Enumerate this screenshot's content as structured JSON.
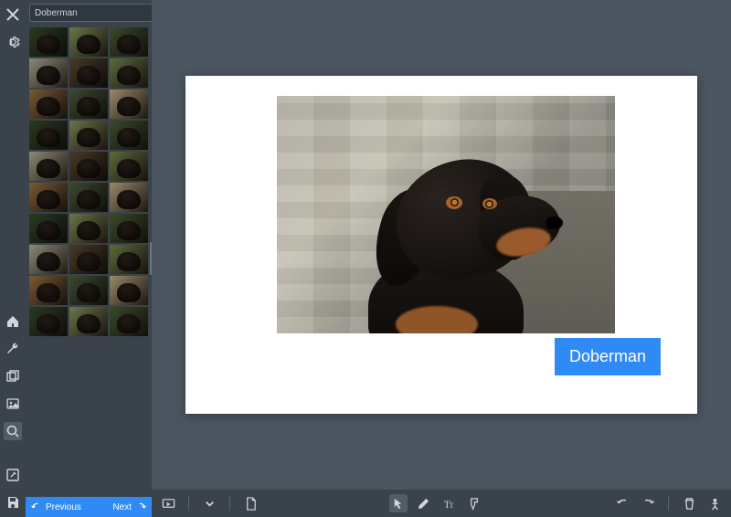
{
  "search": {
    "value": "Doberman",
    "placeholder": "Search"
  },
  "panel_footer": {
    "prev_label": "Previous",
    "next_label": "Next"
  },
  "slide": {
    "textbox_label": "Doberman"
  },
  "thumbnails": [
    [
      {
        "label": ""
      },
      {
        "label": ""
      },
      {
        "label": ""
      }
    ],
    [
      {
        "label": ""
      },
      {
        "label": ""
      },
      {
        "label": ""
      }
    ],
    [
      {
        "label": ""
      },
      {
        "label": ""
      },
      {
        "label": ""
      }
    ],
    [
      {
        "label": ""
      },
      {
        "label": ""
      },
      {
        "label": ""
      }
    ],
    [
      {
        "label": ""
      },
      {
        "label": ""
      },
      {
        "label": ""
      }
    ],
    [
      {
        "label": ""
      },
      {
        "label": ""
      },
      {
        "label": ""
      }
    ],
    [
      {
        "label": ""
      },
      {
        "label": ""
      },
      {
        "label": ""
      }
    ],
    [
      {
        "label": ""
      },
      {
        "label": ""
      },
      {
        "label": ""
      }
    ],
    [
      {
        "label": ""
      },
      {
        "label": ""
      },
      {
        "label": ""
      }
    ],
    [
      {
        "label": ""
      },
      {
        "label": ""
      },
      {
        "label": ""
      }
    ]
  ],
  "colors": {
    "accent": "#2f8af5",
    "bg_dark": "#3a434c",
    "bg_canvas": "#4a5560"
  }
}
